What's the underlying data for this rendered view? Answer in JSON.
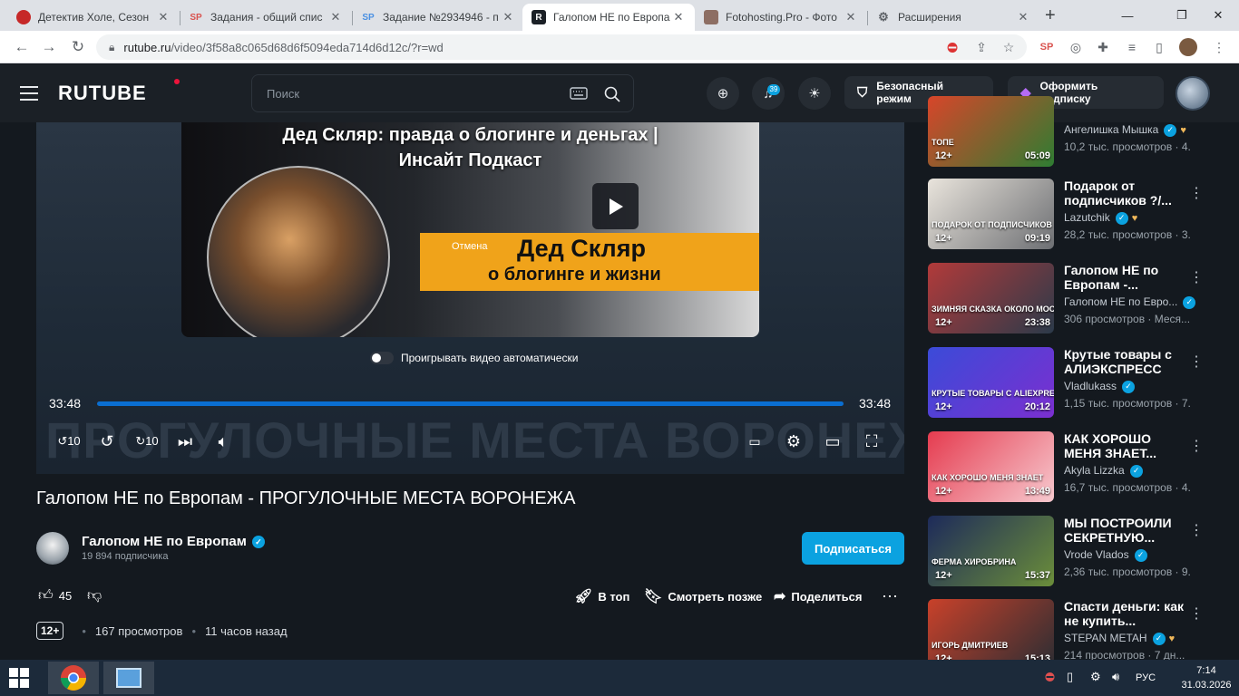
{
  "browser": {
    "tabs": [
      {
        "title": "Детектив Холе, Сезон",
        "fav_color": "#c62828",
        "fav_text": ""
      },
      {
        "title": "Задания - общий спис",
        "fav_color": "#e8eaed",
        "fav_text": "SP"
      },
      {
        "title": "Задание №2934946 - п",
        "fav_color": "#e8eaed",
        "fav_text": "SP"
      },
      {
        "title": "Галопом НЕ по Европа",
        "fav_color": "#1b2026",
        "fav_text": "R"
      },
      {
        "title": "Fotohosting.Pro - Фото",
        "fav_color": "#8d6e63",
        "fav_text": ""
      },
      {
        "title": "Расширения",
        "fav_color": "#e8eaed",
        "fav_text": "⚙"
      }
    ],
    "url_host": "rutube.ru",
    "url_path": "/video/3f58a8c065d68d6f5094eda714d6d12c/?r=wd"
  },
  "header": {
    "logo": "RUTUBE",
    "search_placeholder": "Поиск",
    "notifications_count": "39",
    "safe_mode": "Безопасный режим",
    "subscribe_plan": "Оформить подписку"
  },
  "player": {
    "next_title_line1": "Дед Скляр: правда о блогинге и деньгах |",
    "next_title_line2": "Инсайт Подкаст",
    "banner_line1": "Дед Скляр",
    "banner_line2": "о блогинге и жизни",
    "cancel": "Отмена",
    "autoplay_label": "Проигрывать видео автоматически",
    "time_current": "33:48",
    "time_total": "33:48",
    "progress": 1.0,
    "background_text": "ПРОГУЛОЧНЫЕ МЕСТА ВОРОНЕЖА"
  },
  "video": {
    "title": "Галопом НЕ по Европам - ПРОГУЛОЧНЫЕ МЕСТА ВОРОНЕЖА",
    "channel": "Галопом НЕ по Европам",
    "subscribers": "19 894 подписчика",
    "subscribe_btn": "Подписаться",
    "likes": "45",
    "to_top": "В топ",
    "watch_later": "Смотреть позже",
    "share": "Поделиться",
    "age": "12+",
    "views": "167 просмотров",
    "ago": "11 часов назад"
  },
  "sidebar": [
    {
      "title": "",
      "author": "Ангелишка Мышка",
      "meta": "10,2 тыс. просмотров · 4.",
      "age": "12+",
      "duration": "05:09",
      "caption": "ТОПЕ",
      "colors": [
        "#d8452a",
        "#2e7d32"
      ],
      "heart": true,
      "verified": true
    },
    {
      "title": "Подарок от подписчиков ?/...",
      "author": "Lazutchik",
      "meta": "28,2 тыс. просмотров · 3.",
      "age": "12+",
      "duration": "09:19",
      "caption": "ПОДАРОК ОТ ПОДПИСЧИКОВ",
      "colors": [
        "#e9e4dc",
        "#6d6f73"
      ],
      "heart": true,
      "verified": true
    },
    {
      "title": "Галопом НЕ по Европам -...",
      "author": "Галопом НЕ по Евро...",
      "meta": "306 просмотров · Меся...",
      "age": "12+",
      "duration": "23:38",
      "caption": "ЗИМНЯЯ СКАЗКА ОКОЛО МОСКВЫ",
      "colors": [
        "#b23a3a",
        "#2b3a4a"
      ],
      "heart": false,
      "verified": true
    },
    {
      "title": "Крутые товары с АЛИЭКСПРЕСС",
      "author": "Vladlukass",
      "meta": "1,15 тыс. просмотров · 7.",
      "age": "12+",
      "duration": "20:12",
      "caption": "КРУТЫЕ ТОВАРЫ С ALIEXPRESS",
      "colors": [
        "#3b4bd8",
        "#7b2fd0"
      ],
      "heart": false,
      "verified": true
    },
    {
      "title": "КАК ХОРОШО МЕНЯ ЗНАЕТ...",
      "author": "Akyla Lizzka",
      "meta": "16,7 тыс. просмотров · 4.",
      "age": "12+",
      "duration": "13:49",
      "caption": "КАК ХОРОШО МЕНЯ ЗНАЕТ",
      "colors": [
        "#e53b4f",
        "#f7c9cf"
      ],
      "heart": false,
      "verified": true
    },
    {
      "title": "МЫ ПОСТРОИЛИ СЕКРЕТНУЮ...",
      "author": "Vrode Vlados",
      "meta": "2,36 тыс. просмотров · 9.",
      "age": "12+",
      "duration": "15:37",
      "caption": "ФЕРМА ХИРОБРИНА",
      "colors": [
        "#1d2a5a",
        "#6b8e3a"
      ],
      "heart": false,
      "verified": true
    },
    {
      "title": "Спасти деньги: как не купить...",
      "author": "STEPAN METAH",
      "meta": "214 просмотров · 7 дн...",
      "age": "12+",
      "duration": "15:13",
      "caption": "ИГОРЬ ДМИТРИЕВ",
      "colors": [
        "#c9412a",
        "#2a2d33"
      ],
      "heart": true,
      "verified": true
    }
  ],
  "taskbar": {
    "lang": "РУС",
    "time": "7:14",
    "date": "31.03.2026"
  }
}
